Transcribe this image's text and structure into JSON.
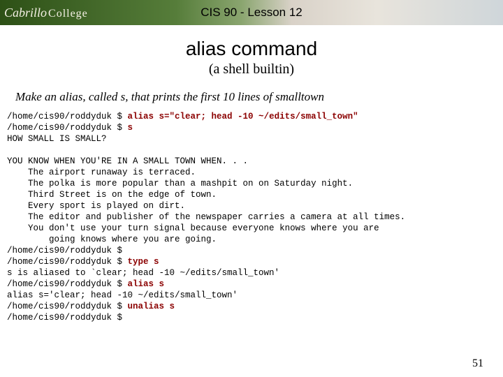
{
  "header": {
    "logo_script": "Cabrillo",
    "logo_serif": "College",
    "course_title": "CIS 90 - Lesson 12"
  },
  "title": "alias command",
  "subtitle": "(a shell builtin)",
  "instruction": "Make an alias, called s, that prints the first 10 lines of smalltown",
  "prompt": "/home/cis90/roddyduk $ ",
  "cmds": {
    "alias_def": "alias s=\"clear; head -10 ~/edits/small_town\"",
    "run_s": "s",
    "type_s": "type s",
    "alias_s": "alias s",
    "unalias_s": "unalias s"
  },
  "out": {
    "how_small": "HOW SMALL IS SMALL?",
    "blank": "",
    "you_know": "YOU KNOW WHEN YOU'RE IN A SMALL TOWN WHEN. . .",
    "l1": "    The airport runaway is terraced.",
    "l2": "    The polka is more popular than a mashpit on on Saturday night.",
    "l3": "    Third Street is on the edge of town.",
    "l4": "    Every sport is played on dirt.",
    "l5": "    The editor and publisher of the newspaper carries a camera at all times.",
    "l6": "    You don't use your turn signal because everyone knows where you are",
    "l7": "        going knows where you are going.",
    "type_out": "s is aliased to `clear; head -10 ~/edits/small_town'",
    "alias_out": "alias s='clear; head -10 ~/edits/small_town'"
  },
  "page_number": "51"
}
